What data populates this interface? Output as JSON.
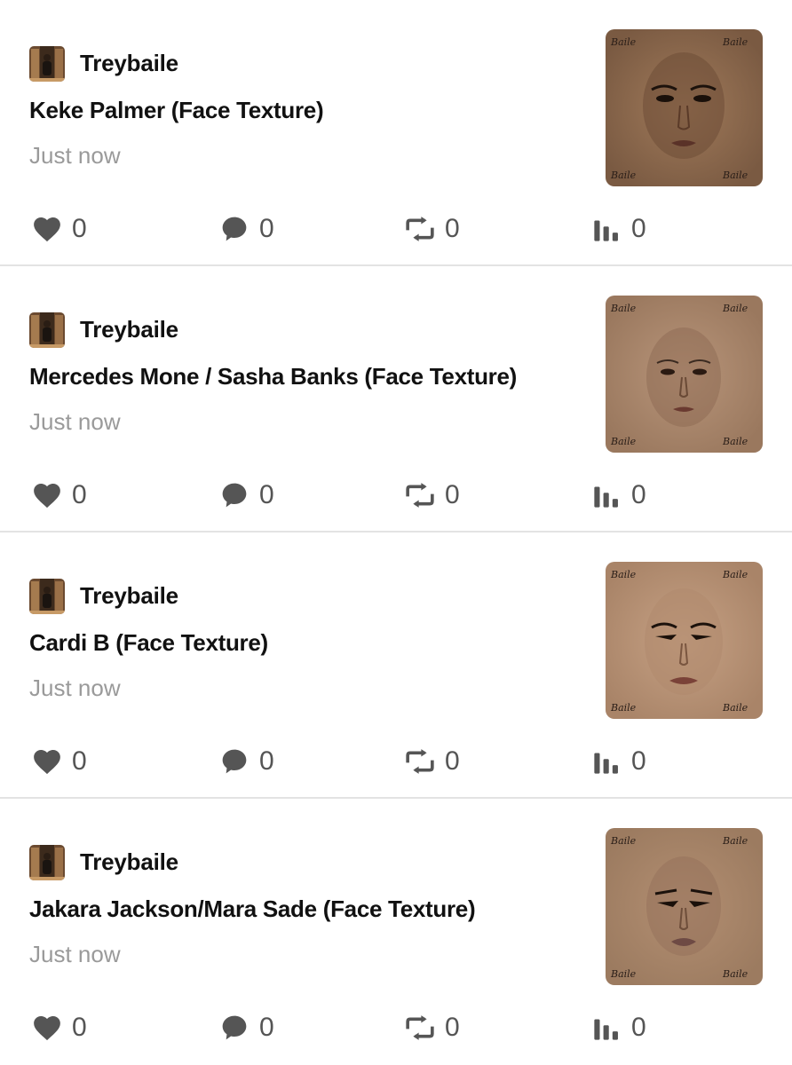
{
  "feed": {
    "posts": [
      {
        "username": "Treybaile",
        "title": "Keke Palmer (Face Texture)",
        "time": "Just now",
        "likes": "0",
        "comments": "0",
        "reposts": "0",
        "views": "0",
        "thumb_tone": "#8a6a50"
      },
      {
        "username": "Treybaile",
        "title": "Mercedes Mone / Sasha Banks (Face Texture)",
        "time": "Just now",
        "likes": "0",
        "comments": "0",
        "reposts": "0",
        "views": "0",
        "thumb_tone": "#a37f64"
      },
      {
        "username": "Treybaile",
        "title": "Cardi B (Face Texture)",
        "time": "Just now",
        "likes": "0",
        "comments": "0",
        "reposts": "0",
        "views": "0",
        "thumb_tone": "#b08c71"
      },
      {
        "username": "Treybaile",
        "title": "Jakara Jackson/Mara Sade (Face Texture)",
        "time": "Just now",
        "likes": "0",
        "comments": "0",
        "reposts": "0",
        "views": "0",
        "thumb_tone": "#a88769"
      }
    ]
  },
  "icons": {
    "like": "heart-icon",
    "comment": "comment-bubble-icon",
    "repost": "repost-icon",
    "views": "bar-chart-icon"
  },
  "colors": {
    "icon": "#555555",
    "muted_text": "#9a9a9a",
    "divider": "#e3e3e3"
  }
}
